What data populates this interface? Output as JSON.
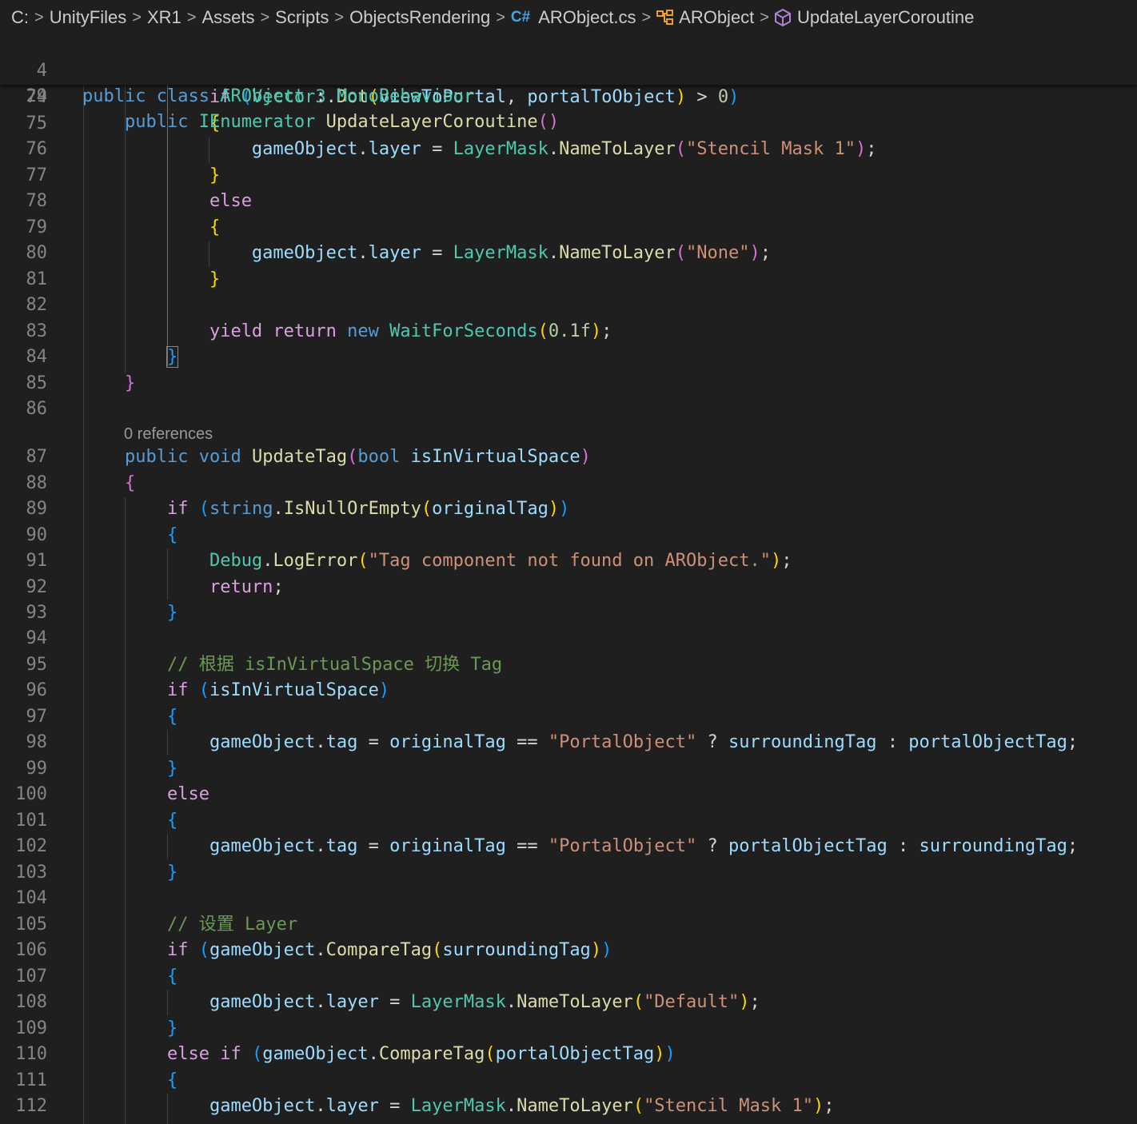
{
  "breadcrumb": {
    "items": [
      "C:",
      "UnityFiles",
      "XR1",
      "Assets",
      "Scripts",
      "ObjectsRendering",
      "ARObject.cs",
      "ARObject",
      "UpdateLayerCoroutine"
    ],
    "icons": [
      "csharp-file-icon",
      "class-icon",
      "method-icon"
    ]
  },
  "sticky_lines": [
    {
      "n": "4",
      "text": "public class ARObject : MonoBehaviour"
    },
    {
      "n": "29",
      "text": "    public IEnumerator UpdateLayerCoroutine()"
    }
  ],
  "codelens": "0 references",
  "lines": [
    {
      "n": "74",
      "text": "            if (Vector3.Dot(viewToPortal, portalToObject) > 0)"
    },
    {
      "n": "75",
      "text": "            {"
    },
    {
      "n": "76",
      "text": "                gameObject.layer = LayerMask.NameToLayer(\"Stencil Mask 1\");"
    },
    {
      "n": "77",
      "text": "            }"
    },
    {
      "n": "78",
      "text": "            else"
    },
    {
      "n": "79",
      "text": "            {"
    },
    {
      "n": "80",
      "text": "                gameObject.layer = LayerMask.NameToLayer(\"None\");"
    },
    {
      "n": "81",
      "text": "            }"
    },
    {
      "n": "82",
      "text": ""
    },
    {
      "n": "83",
      "text": "            yield return new WaitForSeconds(0.1f);"
    },
    {
      "n": "84",
      "text": "        }"
    },
    {
      "n": "85",
      "text": "    }"
    },
    {
      "n": "86",
      "text": ""
    },
    {
      "n": "87",
      "text": "    public void UpdateTag(bool isInVirtualSpace)"
    },
    {
      "n": "88",
      "text": "    {"
    },
    {
      "n": "89",
      "text": "        if (string.IsNullOrEmpty(originalTag))"
    },
    {
      "n": "90",
      "text": "        {"
    },
    {
      "n": "91",
      "text": "            Debug.LogError(\"Tag component not found on ARObject.\");"
    },
    {
      "n": "92",
      "text": "            return;"
    },
    {
      "n": "93",
      "text": "        }"
    },
    {
      "n": "94",
      "text": ""
    },
    {
      "n": "95",
      "text": "        // 根据 isInVirtualSpace 切换 Tag"
    },
    {
      "n": "96",
      "text": "        if (isInVirtualSpace)"
    },
    {
      "n": "97",
      "text": "        {"
    },
    {
      "n": "98",
      "text": "            gameObject.tag = originalTag == \"PortalObject\" ? surroundingTag : portalObjectTag;"
    },
    {
      "n": "99",
      "text": "        }"
    },
    {
      "n": "100",
      "text": "        else"
    },
    {
      "n": "101",
      "text": "        {"
    },
    {
      "n": "102",
      "text": "            gameObject.tag = originalTag == \"PortalObject\" ? portalObjectTag : surroundingTag;"
    },
    {
      "n": "103",
      "text": "        }"
    },
    {
      "n": "104",
      "text": ""
    },
    {
      "n": "105",
      "text": "        // 设置 Layer"
    },
    {
      "n": "106",
      "text": "        if (gameObject.CompareTag(surroundingTag))"
    },
    {
      "n": "107",
      "text": "        {"
    },
    {
      "n": "108",
      "text": "            gameObject.layer = LayerMask.NameToLayer(\"Default\");"
    },
    {
      "n": "109",
      "text": "        }"
    },
    {
      "n": "110",
      "text": "        else if (gameObject.CompareTag(portalObjectTag))"
    },
    {
      "n": "111",
      "text": "        {"
    },
    {
      "n": "112",
      "text": "            gameObject.layer = LayerMask.NameToLayer(\"Stencil Mask 1\");"
    }
  ],
  "colors": {
    "background": "#1f1f1f",
    "keyword": "#569cd6",
    "control": "#d8a0df",
    "type": "#4ec9b0",
    "function": "#dcdcaa",
    "variable": "#9cdcfe",
    "string": "#ce9178",
    "number": "#b5cea8",
    "comment": "#6a9955",
    "line_number": "#858585"
  }
}
